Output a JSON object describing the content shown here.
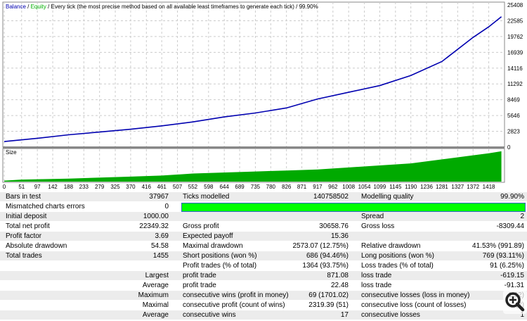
{
  "chart_header": {
    "balance": "Balance",
    "equity": "Equity",
    "separator": " / ",
    "method": "Every tick (the most precise method based on all available least timeframes to generate each tick)",
    "quality": "99.90%"
  },
  "colors": {
    "balance": "#0000b0",
    "equity": "#00b000",
    "size": "#00aa00",
    "quality_bar": "#00ff00"
  },
  "chart_data": [
    {
      "type": "line",
      "title": "",
      "series": [
        {
          "name": "Balance",
          "x": [
            0,
            100,
            188,
            279,
            370,
            461,
            552,
            644,
            735,
            826,
            917,
            1008,
            1099,
            1190,
            1281,
            1372,
            1418,
            1455
          ],
          "y": [
            1000,
            1600,
            2200,
            2700,
            3200,
            3800,
            4500,
            5400,
            6100,
            7000,
            8600,
            9800,
            11000,
            12800,
            15300,
            19600,
            21500,
            23300
          ]
        }
      ],
      "yticks": [
        0,
        2823,
        5646,
        8469,
        11292,
        14116,
        16939,
        19762,
        22585,
        25408
      ],
      "ylim": [
        0,
        25408
      ],
      "xlim": [
        0,
        1460
      ],
      "grid": true
    },
    {
      "type": "area",
      "title": "Size",
      "x": [
        0,
        50,
        188,
        370,
        461,
        552,
        735,
        826,
        917,
        1008,
        1099,
        1190,
        1281,
        1372,
        1418,
        1455
      ],
      "values": [
        0.5,
        1,
        1.5,
        2.5,
        3,
        4,
        5,
        5.5,
        6,
        7,
        8,
        9,
        11,
        13,
        14,
        15
      ],
      "xticks": [
        0,
        51,
        97,
        142,
        188,
        233,
        279,
        325,
        370,
        416,
        461,
        507,
        552,
        598,
        644,
        689,
        735,
        780,
        826,
        871,
        917,
        962,
        1008,
        1054,
        1099,
        1145,
        1190,
        1236,
        1281,
        1327,
        1372,
        1418
      ],
      "xlim": [
        0,
        1460
      ],
      "grid": true
    }
  ],
  "report": {
    "rows": [
      [
        "Bars in test",
        "37967",
        "Ticks modelled",
        "140758502",
        "Modelling quality",
        "99.90%"
      ],
      [
        "Mismatched charts errors",
        "0",
        "",
        "",
        "",
        ""
      ],
      [
        "Initial deposit",
        "1000.00",
        "",
        "",
        "Spread",
        "2"
      ],
      [
        "Total net profit",
        "22349.32",
        "Gross profit",
        "30658.76",
        "Gross loss",
        "-8309.44"
      ],
      [
        "Profit factor",
        "3.69",
        "Expected payoff",
        "15.36",
        "",
        ""
      ],
      [
        "Absolute drawdown",
        "54.58",
        "Maximal drawdown",
        "2573.07 (12.75%)",
        "Relative drawdown",
        "41.53% (991.89)"
      ],
      [
        "Total trades",
        "1455",
        "Short positions (won %)",
        "686 (94.46%)",
        "Long positions (won %)",
        "769 (93.11%)"
      ],
      [
        "",
        "",
        "Profit trades (% of total)",
        "1364 (93.75%)",
        "Loss trades (% of total)",
        "91 (6.25%)"
      ],
      [
        "Largest",
        "",
        "profit trade",
        "871.08",
        "loss trade",
        "-619.15"
      ],
      [
        "Average",
        "",
        "profit trade",
        "22.48",
        "loss trade",
        "-91.31"
      ],
      [
        "Maximum",
        "",
        "consecutive wins (profit in money)",
        "69 (1701.02)",
        "consecutive losses (loss in money)",
        "1.92)"
      ],
      [
        "Maximal",
        "",
        "consecutive profit (count of wins)",
        "2319.39 (51)",
        "consecutive loss (count of losses)",
        "(2)"
      ],
      [
        "Average",
        "",
        "consecutive wins",
        "17",
        "consecutive losses",
        "1"
      ]
    ]
  }
}
